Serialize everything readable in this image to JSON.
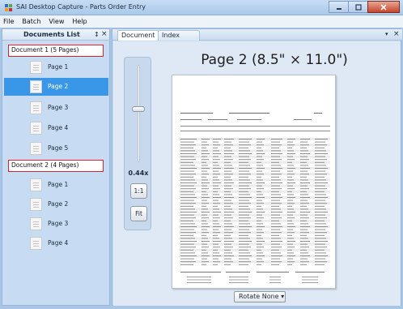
{
  "window": {
    "title": "SAI Desktop Capture - Parts Order Entry",
    "app_icon": "app-logo-icon"
  },
  "menu": {
    "items": [
      "File",
      "Batch",
      "View",
      "Help"
    ]
  },
  "documents_panel": {
    "title": "Documents List",
    "pin_glyph": "↕",
    "close_glyph": "×",
    "documents": [
      {
        "label": "Document 1 (5 Pages)",
        "pages": [
          "Page 1",
          "Page 2",
          "Page 3",
          "Page 4",
          "Page 5"
        ]
      },
      {
        "label": "Document 2 (4 Pages)",
        "pages": [
          "Page 1",
          "Page 2",
          "Page 3",
          "Page 4"
        ]
      }
    ],
    "selected": {
      "document": 1,
      "page": 2
    }
  },
  "viewer": {
    "tabs": [
      "Document",
      "Index Data"
    ],
    "active_tab": "Document",
    "tab_dropdown_glyph": "▾",
    "tab_close_glyph": "×",
    "heading": "Page 2 (8.5\" × 11.0\")",
    "zoom": {
      "level": "0.44x",
      "fraction": 0.55,
      "one_to_one_label": "1:1",
      "fit_label": "Fit"
    },
    "rotate": {
      "label": "Rotate None",
      "arrow": "▾"
    }
  },
  "colors": {
    "accent": "#3a96e6",
    "highlight_border": "#d9242b",
    "panel_bg": "#c7dcf2"
  }
}
